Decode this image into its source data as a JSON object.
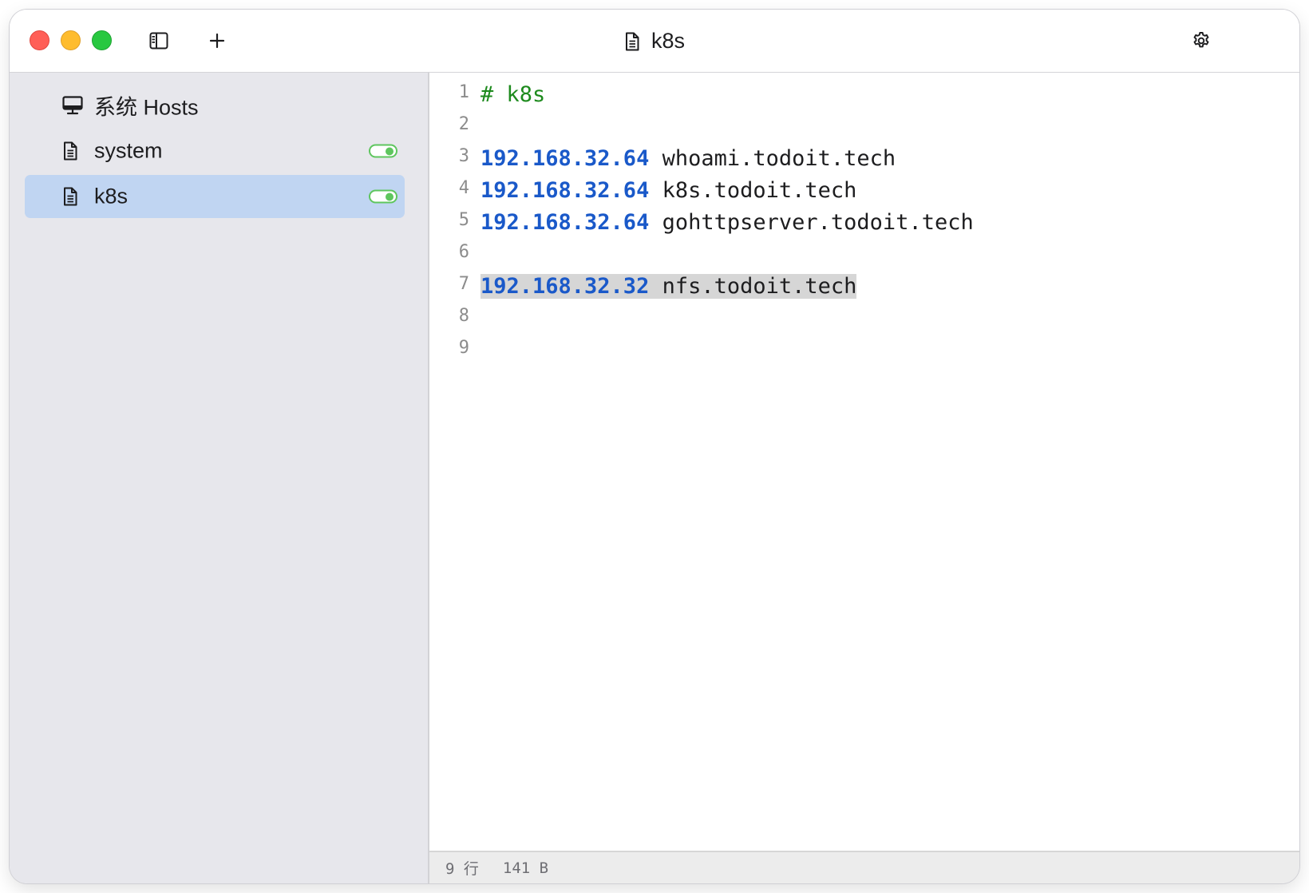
{
  "window": {
    "title": "k8s",
    "toolbar": {
      "sidebar_toggle_icon": "sidebar-toggle-icon",
      "add_icon": "plus-icon",
      "settings_icon": "gear-icon"
    }
  },
  "sidebar": {
    "items": [
      {
        "label": "系统 Hosts",
        "icon": "monitor-icon",
        "has_toggle": false
      },
      {
        "label": "system",
        "icon": "document-icon",
        "has_toggle": true,
        "toggle_on": true
      },
      {
        "label": "k8s",
        "icon": "document-icon",
        "has_toggle": true,
        "toggle_on": true,
        "selected": true
      }
    ]
  },
  "editor": {
    "line_numbers": [
      "1",
      "2",
      "3",
      "4",
      "5",
      "6",
      "7",
      "8",
      "9"
    ],
    "lines": [
      {
        "kind": "comment",
        "text": "# k8s"
      },
      {
        "kind": "blank",
        "text": ""
      },
      {
        "kind": "entry",
        "ip": "192.168.32.64",
        "host": "whoami.todoit.tech"
      },
      {
        "kind": "entry",
        "ip": "192.168.32.64",
        "host": "k8s.todoit.tech"
      },
      {
        "kind": "entry",
        "ip": "192.168.32.64",
        "host": "gohttpserver.todoit.tech"
      },
      {
        "kind": "blank",
        "text": ""
      },
      {
        "kind": "entry",
        "ip": "192.168.32.32",
        "host": "nfs.todoit.tech",
        "highlighted": true
      },
      {
        "kind": "blank",
        "text": ""
      },
      {
        "kind": "blank",
        "text": ""
      }
    ]
  },
  "statusbar": {
    "lines": "9 行",
    "size": "141 B"
  },
  "colors": {
    "ip": "#1a59c9",
    "comment": "#1d8a1d",
    "selected_item": "#c0d5f2",
    "toggle": "#5ec65e"
  }
}
